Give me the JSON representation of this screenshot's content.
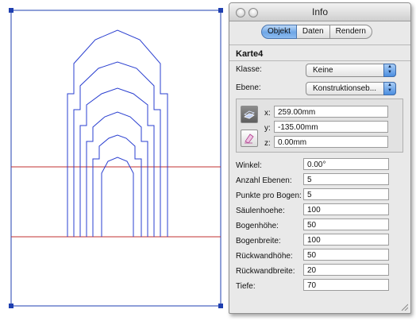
{
  "window": {
    "title": "Info",
    "tabs": [
      {
        "label": "Objekt",
        "active": true
      },
      {
        "label": "Daten",
        "active": false
      },
      {
        "label": "Rendern",
        "active": false
      }
    ]
  },
  "object": {
    "name": "Karte4",
    "klasse_label": "Klasse:",
    "klasse_value": "Keine",
    "ebene_label": "Ebene:",
    "ebene_value": "Konstruktionseb..."
  },
  "coordinates": {
    "x_label": "x:",
    "x_value": "259.00mm",
    "y_label": "y:",
    "y_value": "-135.00mm",
    "z_label": "z:",
    "z_value": "0.00mm",
    "icons": [
      "plane-icon",
      "eraser-icon"
    ]
  },
  "parameters": [
    {
      "label": "Winkel:",
      "value": "0.00°"
    },
    {
      "label": "Anzahl Ebenen:",
      "value": "5"
    },
    {
      "label": "Punkte pro Bogen:",
      "value": "5"
    },
    {
      "label": "Säulenhoehe:",
      "value": "100"
    },
    {
      "label": "Bogenhöhe:",
      "value": "50"
    },
    {
      "label": "Bogenbreite:",
      "value": "100"
    },
    {
      "label": "Rückwandhöhe:",
      "value": "50"
    },
    {
      "label": "Rückwandbreite:",
      "value": "20"
    },
    {
      "label": "Tiefe:",
      "value": "70"
    }
  ],
  "colors": {
    "selection": "#1f3fb0",
    "drawing_blue": "#2a3fd0",
    "drawing_red": "#c03030",
    "tab_active": "#6fa6e6"
  }
}
